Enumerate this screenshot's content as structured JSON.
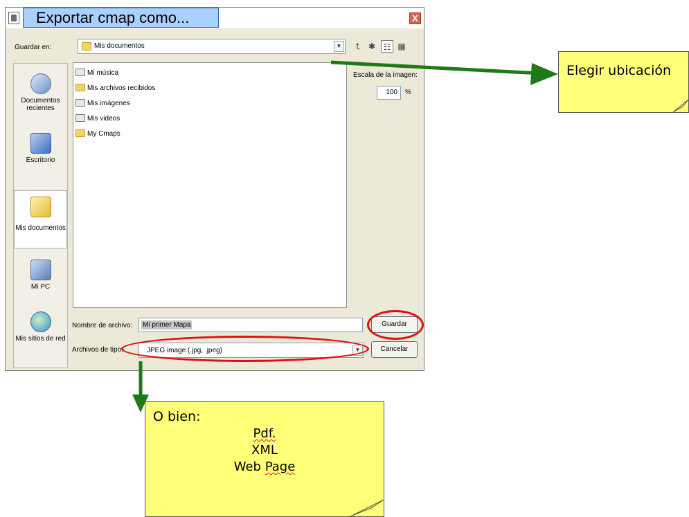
{
  "dialog": {
    "title": "Exportar cmap como...",
    "close_label": "X",
    "save_in_label": "Guardar en:",
    "save_in_value": "Mis documentos",
    "image_scale_label": "Escala de la imagen:",
    "image_scale_value": "100",
    "percent_label": "%",
    "filename_label": "Nombre de archivo:",
    "filename_value": "Mi primer Mapa",
    "filetype_label": "Archivos de tipo:",
    "filetype_value": "JPEG image (.jpg, .jpeg)",
    "save_button": "Guardar",
    "cancel_button": "Cancelar"
  },
  "places": [
    {
      "label1": "Documentos",
      "label2": "recientes",
      "icon": "recent-documents-icon"
    },
    {
      "label1": "Escritorio",
      "label2": "",
      "icon": "desktop-icon"
    },
    {
      "label1": "Mis documentos",
      "label2": "",
      "icon": "my-documents-icon"
    },
    {
      "label1": "Mi PC",
      "label2": "",
      "icon": "my-computer-icon"
    },
    {
      "label1": "Mis sitios de red",
      "label2": "",
      "icon": "network-places-icon"
    }
  ],
  "files": [
    {
      "name": "Mi música",
      "icon": "music-folder-icon"
    },
    {
      "name": "Mis archivos recibidos",
      "icon": "folder-icon"
    },
    {
      "name": "Mis imágenes",
      "icon": "pictures-folder-icon"
    },
    {
      "name": "Mis videos",
      "icon": "videos-folder-icon"
    },
    {
      "name": "My Cmaps",
      "icon": "folder-icon"
    }
  ],
  "notes": {
    "location": "Elegir ubicación",
    "formats_title": "O bien:",
    "format1": "Pdf.",
    "format2": "XML",
    "format3": "Web Page"
  },
  "colors": {
    "arrow": "#1e7a16",
    "note": "#ffff78",
    "highlight": "#e01010",
    "title_box": "#aad0ff"
  }
}
